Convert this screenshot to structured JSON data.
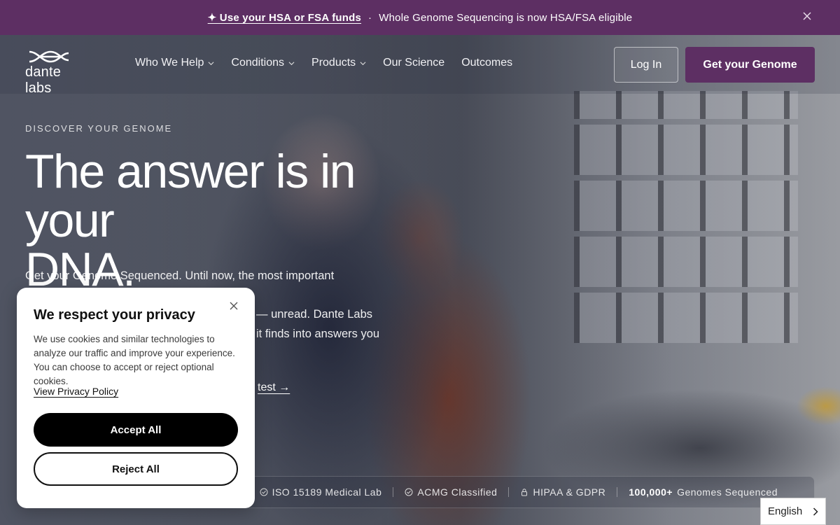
{
  "announcement": {
    "link": "✦ Use your HSA or FSA funds",
    "separator": "·",
    "message": "Whole Genome Sequencing is now HSA/FSA eligible",
    "icons": {
      "close": "close-icon"
    }
  },
  "header": {
    "logo_text": "dante labs",
    "nav": [
      {
        "label": "Who We Help",
        "has_dropdown": true
      },
      {
        "label": "Conditions",
        "has_dropdown": true
      },
      {
        "label": "Products",
        "has_dropdown": true
      },
      {
        "label": "Our Science",
        "has_dropdown": false
      },
      {
        "label": "Outcomes",
        "has_dropdown": false
      }
    ],
    "login_label": "Log In",
    "cta_label": "Get your Genome"
  },
  "hero": {
    "eyebrow": "DISCOVER YOUR GENOME",
    "headline_line1": "The answer is in your",
    "headline_line2": "DNA.",
    "subcopy_line1": "Get your Genome Sequenced. Until now, the most important information",
    "subcopy_line2": "— unread. Dante Labs",
    "subcopy_line3": "it finds into answers you",
    "test_link": "test →"
  },
  "trust_bar": {
    "badges": [
      "ISO 15189 Medical Lab",
      "ACMG Classified",
      "HIPAA & GDPR"
    ],
    "stat_number": "100,000+",
    "stat_label": "Genomes Sequenced"
  },
  "cookie_banner": {
    "title": "We respect your privacy",
    "description": "We use cookies and similar technologies to analyze our traffic and improve your experience. You can choose to accept or reject optional cookies.",
    "policy_link": "View Privacy Policy",
    "accept_label": "Accept All",
    "reject_label": "Reject All"
  },
  "language": {
    "selected": "English"
  },
  "colors": {
    "brand_purple": "#5d2f63",
    "accept_button": "#000000"
  }
}
